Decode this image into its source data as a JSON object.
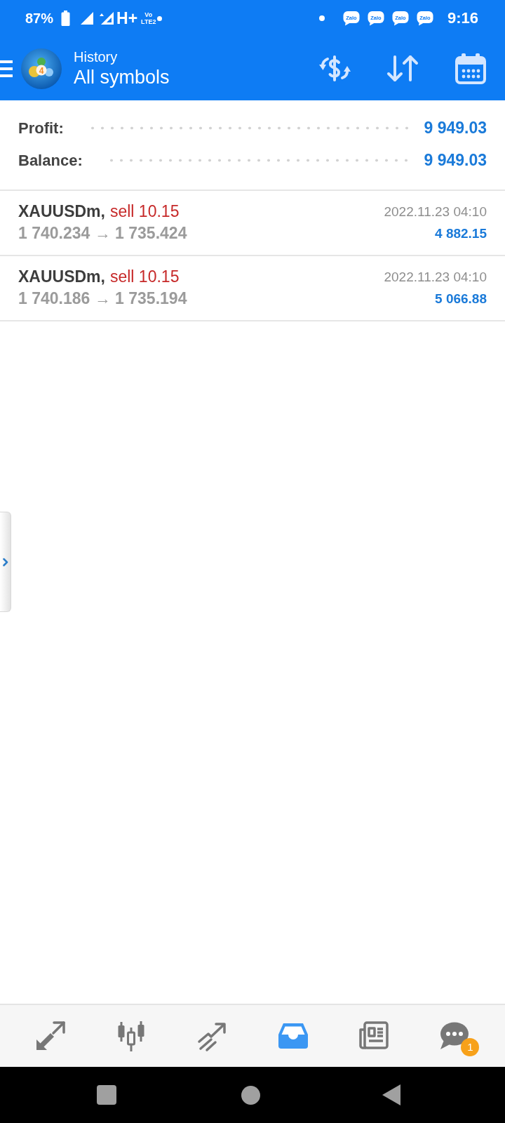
{
  "status_bar": {
    "battery": "87%",
    "network": "H+",
    "volte": [
      "Vo",
      "LTE2"
    ],
    "notifications": [
      {
        "label": "Zalo"
      },
      {
        "label": "Zalo"
      },
      {
        "label": "Zalo"
      },
      {
        "label": "Zalo"
      }
    ],
    "time": "9:16"
  },
  "app_bar": {
    "logo_label": "4",
    "title": "History",
    "subtitle": "All symbols"
  },
  "summary": [
    {
      "label": "Profit:",
      "value": "9 949.03"
    },
    {
      "label": "Balance:",
      "value": "9 949.03"
    }
  ],
  "deals": [
    {
      "symbol": "XAUUSDm,",
      "order": "sell 10.15",
      "prices": "1 740.234 → 1 735.424",
      "time": "2022.11.23 04:10",
      "profit": "4 882.15"
    },
    {
      "symbol": "XAUUSDm,",
      "order": "sell 10.15",
      "prices": "1 740.186 → 1 735.194",
      "time": "2022.11.23 04:10",
      "profit": "5 066.88"
    }
  ],
  "bottom_nav": {
    "items": [
      {
        "kind": "quotes",
        "selected": false
      },
      {
        "kind": "chart",
        "selected": false
      },
      {
        "kind": "trade",
        "selected": false
      },
      {
        "kind": "history",
        "selected": true
      },
      {
        "kind": "news",
        "selected": false
      },
      {
        "kind": "messages",
        "selected": false,
        "badge": "1"
      }
    ]
  }
}
